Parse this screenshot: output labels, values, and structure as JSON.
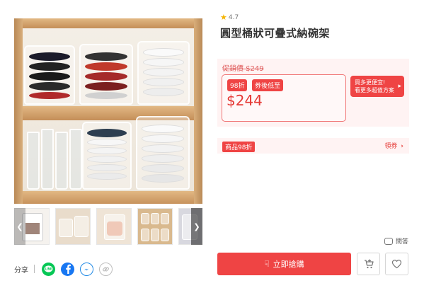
{
  "product": {
    "rating": "4.7",
    "title": "圓型桶狀可疊式納碗架"
  },
  "price": {
    "original": "促銷價 $249",
    "discount_badge": "98折",
    "after_coupon_label": "券後低至",
    "final": "$244",
    "promo_line1": "買多更便宜!",
    "promo_line2": "看更多超值方案"
  },
  "coupon": {
    "tag": "商品98折",
    "link": "領券"
  },
  "share": {
    "label": "分享"
  },
  "qa": {
    "label": "問答"
  },
  "actions": {
    "buy_label": "立即搶購"
  },
  "colors": {
    "accent": "#ef4444",
    "panel_bg": "#fff3f3",
    "line": "#06c755",
    "facebook": "#1877f2",
    "messenger": "#1e88e5"
  },
  "icons": {
    "rating": "star-icon",
    "share_line": "line-icon",
    "share_facebook": "facebook-icon",
    "share_messenger": "messenger-icon",
    "share_link": "link-icon",
    "qa": "chat-bubble-icon",
    "buy": "hand-pointer-icon",
    "cart": "add-to-cart-icon",
    "favorite": "heart-icon",
    "gallery_prev": "chevron-left-icon",
    "gallery_next": "chevron-right-icon"
  }
}
